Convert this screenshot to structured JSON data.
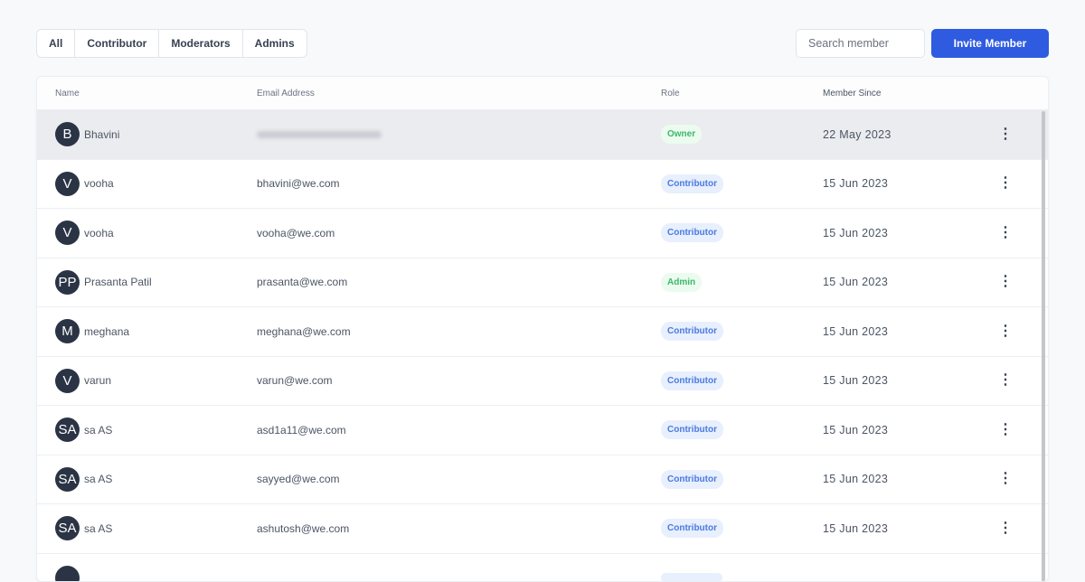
{
  "filters": [
    "All",
    "Contributor",
    "Moderators",
    "Admins"
  ],
  "search": {
    "placeholder": "Search member"
  },
  "invite_label": "Invite Member",
  "columns": {
    "name": "Name",
    "email": "Email Address",
    "role": "Role",
    "since": "Member Since"
  },
  "members": [
    {
      "initials": "B",
      "name": "Bhavini",
      "email": "",
      "email_blurred": true,
      "role": "Owner",
      "since": "22 May 2023"
    },
    {
      "initials": "V",
      "name": "vooha",
      "email": "bhavini@we.com",
      "role": "Contributor",
      "since": "15 Jun 2023"
    },
    {
      "initials": "V",
      "name": "vooha",
      "email": "vooha@we.com",
      "role": "Contributor",
      "since": "15 Jun 2023"
    },
    {
      "initials": "PP",
      "name": "Prasanta Patil",
      "email": "prasanta@we.com",
      "role": "Admin",
      "since": "15 Jun 2023"
    },
    {
      "initials": "M",
      "name": "meghana",
      "email": "meghana@we.com",
      "role": "Contributor",
      "since": "15 Jun 2023"
    },
    {
      "initials": "V",
      "name": "varun",
      "email": "varun@we.com",
      "role": "Contributor",
      "since": "15 Jun 2023"
    },
    {
      "initials": "SA",
      "name": "sa AS",
      "email": "asd1a11@we.com",
      "role": "Contributor",
      "since": "15 Jun 2023"
    },
    {
      "initials": "SA",
      "name": "sa AS",
      "email": "sayyed@we.com",
      "role": "Contributor",
      "since": "15 Jun 2023"
    },
    {
      "initials": "SA",
      "name": "sa AS",
      "email": "ashutosh@we.com",
      "role": "Contributor",
      "since": "15 Jun 2023"
    },
    {
      "initials": "",
      "name": "",
      "email": "",
      "role": "",
      "since": ""
    }
  ],
  "colors": {
    "accent": "#2f5be0",
    "avatar": "#2b3445"
  }
}
